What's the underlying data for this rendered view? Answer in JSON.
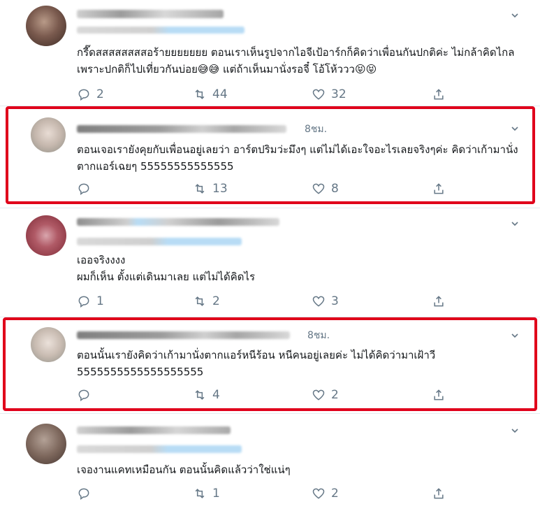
{
  "tweets": [
    {
      "time": "",
      "text": "กรี๊ดสสสสสสสสอร้ายยยยยยย ตอนเราเห็นรูปจากไอจีเป้อาร์กก็คิดว่าเพื่อนกันปกติค่ะ ไม่กล้าคิดไกล เพราะปกติก็ไปเที่ยวกันบ่อย😅😅 แต่ถ้าเห็นมานั่งรอจี๋ โอ้โห้ววว😝😝",
      "replies": "2",
      "retweets": "44",
      "likes": "32"
    },
    {
      "time": "8ชม.",
      "text": "ตอนเจอเรายังคุยกับเพื่อนอยู่เลยว่า อาร์ตปริมว่ะมึงๆ แต่ไม่ได้เอะใจอะไรเลยจริงๆค่ะ คิดว่าเก้ามานั่งตากแอร์เฉยๆ 55555555555555",
      "replies": "",
      "retweets": "13",
      "likes": "8"
    },
    {
      "time": "",
      "text": "เออจริงงงง\nผมก็เห็น ตั้งแต่เดินมาเลย แต่ไม่ได้คิดไร",
      "replies": "1",
      "retweets": "2",
      "likes": "3"
    },
    {
      "time": "8ชม.",
      "text": "ตอนนั้นเรายังคิดว่าเก้ามานั่งตากแอร์หนีร้อน หนีคนอยู่เลยค่ะ ไม่ได้คิดว่ามาเฝ้าวี\n5555555555555555555",
      "replies": "",
      "retweets": "4",
      "likes": "2"
    },
    {
      "time": "",
      "text": "เจองานแคทเหมือนกัน ตอนนั้นคิดแล้วว่าใช่แน่ๆ",
      "replies": "",
      "retweets": "1",
      "likes": "2"
    }
  ],
  "colors": {
    "highlight": "#e0001b",
    "icon": "#657786",
    "text": "#14171a",
    "handle_blur": "#b8dcf5"
  },
  "icons": [
    "reply-icon",
    "retweet-icon",
    "like-icon",
    "share-icon",
    "chevron-down-icon"
  ]
}
